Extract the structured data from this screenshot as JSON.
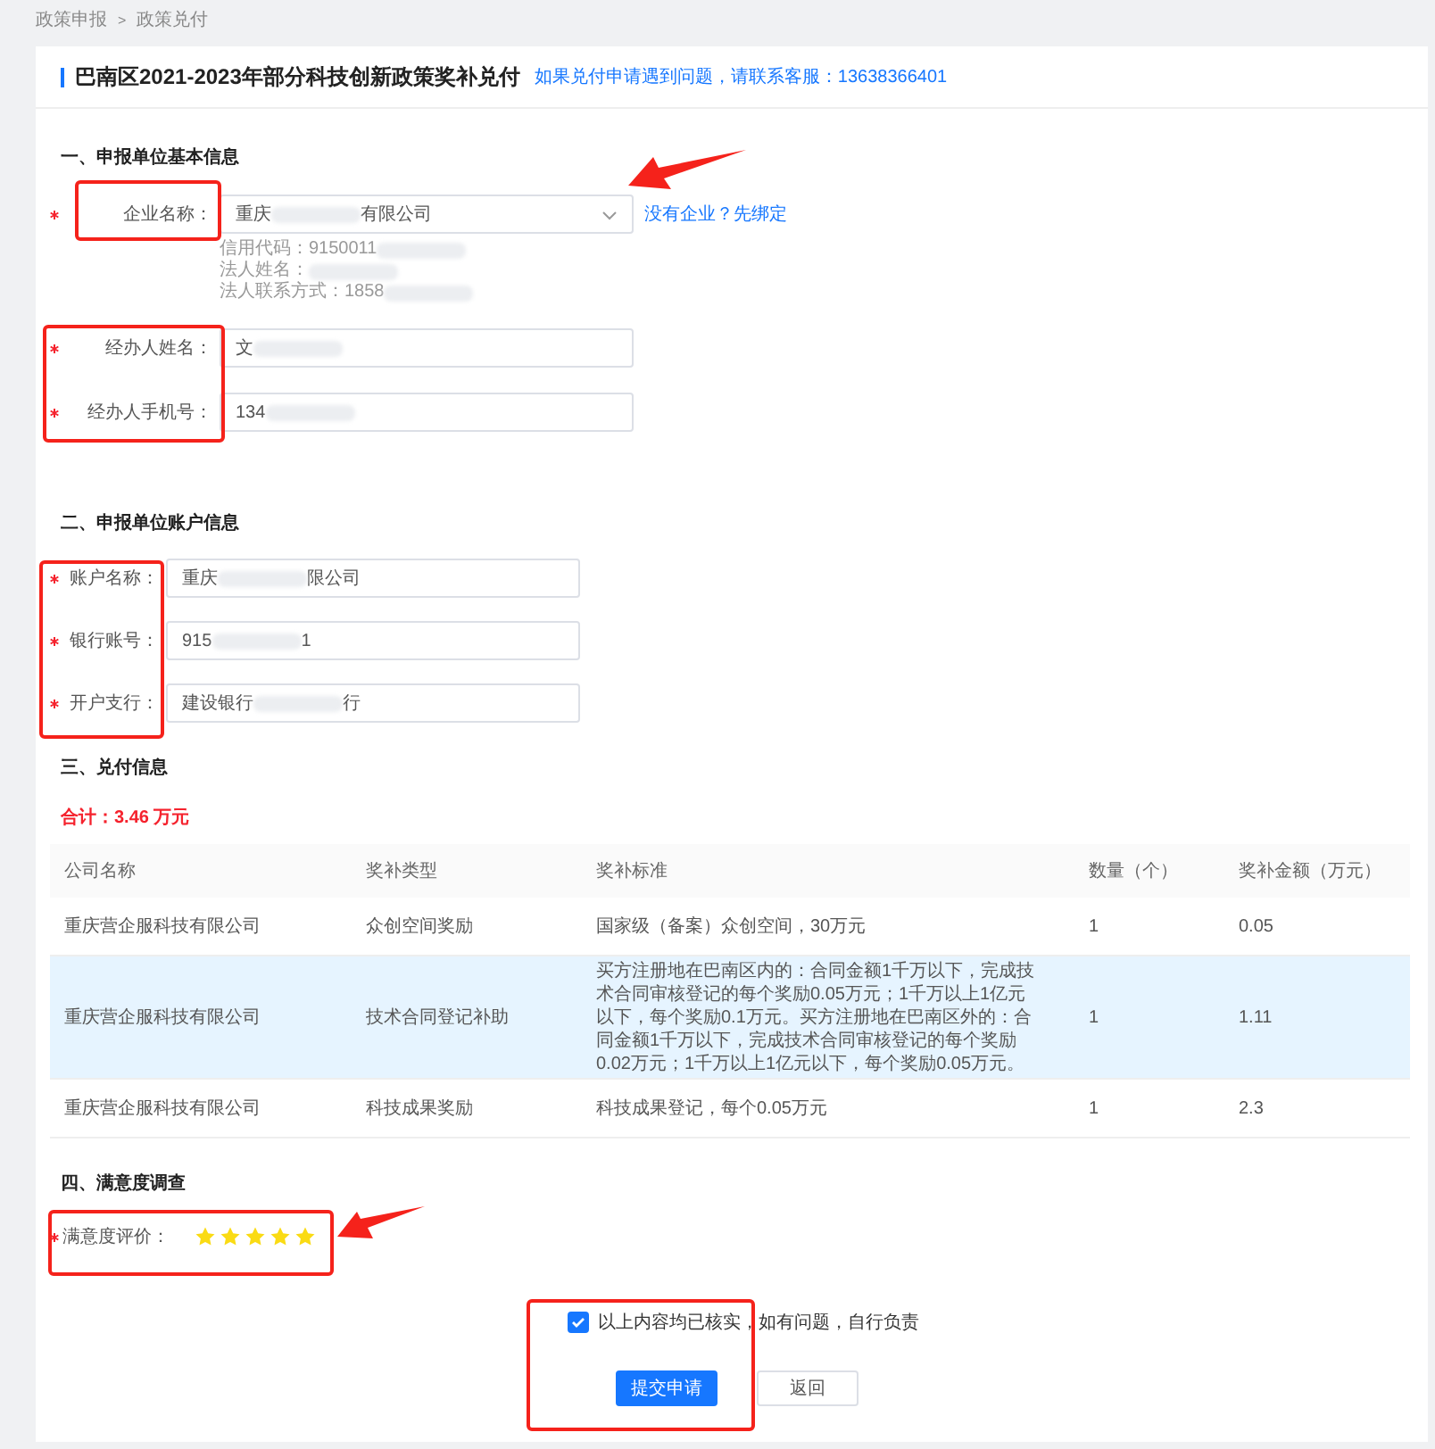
{
  "breadcrumb": [
    "政策申报",
    "政策兑付"
  ],
  "breadcrumb_separator": ">",
  "title": "巴南区2021-2023年部分科技创新政策奖补兑付",
  "help_text": "如果兑付申请遇到问题，请联系客服：13638366401",
  "section_basic": {
    "heading": "一、申报单位基本信息",
    "company": {
      "label": "企业名称：",
      "required": true,
      "value_parts": [
        "重庆",
        "有限公司"
      ],
      "bind_link": "没有企业？先绑定"
    },
    "company_info": [
      {
        "text": "信用代码：9150011"
      },
      {
        "text": "法人姓名："
      },
      {
        "text": "法人联系方式：1858"
      }
    ],
    "fields": [
      {
        "label": "经办人姓名：",
        "required": true,
        "value_parts": [
          "文"
        ]
      },
      {
        "label": "经办人手机号：",
        "required": true,
        "value_parts": [
          "134"
        ]
      }
    ]
  },
  "section_account": {
    "heading": "二、申报单位账户信息",
    "fields": [
      {
        "label": "账户名称：",
        "required": true,
        "value_parts": [
          "重庆",
          "限公司"
        ]
      },
      {
        "label": "银行账号：",
        "required": true,
        "value_parts": [
          "915",
          "1"
        ]
      },
      {
        "label": "开户支行：",
        "required": true,
        "value_parts": [
          "建设银行",
          "行"
        ]
      }
    ]
  },
  "section_payment": {
    "heading": "三、兑付信息",
    "total": "合计：3.46 万元",
    "table": {
      "columns": [
        "公司名称",
        "奖补类型",
        "奖补标准",
        "数量（个）",
        "奖补金额（万元）"
      ],
      "rows": [
        {
          "selected": false,
          "cells": [
            "重庆营企服科技有限公司",
            "众创空间奖励",
            "国家级（备案）众创空间，30万元",
            "1",
            "0.05"
          ]
        },
        {
          "selected": true,
          "cells": [
            "重庆营企服科技有限公司",
            "技术合同登记补助",
            "买方注册地在巴南区内的：合同金额1千万以下，完成技术合同审核登记的每个奖励0.05万元；1千万以上1亿元以下，每个奖励0.1万元。买方注册地在巴南区外的：合同金额1千万以下，完成技术合同审核登记的每个奖励0.02万元；1千万以上1亿元以下，每个奖励0.05万元。",
            "1",
            "1.11"
          ]
        },
        {
          "selected": false,
          "cells": [
            "重庆营企服科技有限公司",
            "科技成果奖励",
            "科技成果登记，每个0.05万元",
            "1",
            "2.3"
          ]
        }
      ]
    }
  },
  "section_survey": {
    "heading": "四、满意度调查",
    "label": "满意度评价：",
    "required": true,
    "stars": 5
  },
  "confirm": {
    "checked": true,
    "label": "以上内容均已核实，如有问题，自行负责"
  },
  "buttons": [
    {
      "label": "提交申请",
      "kind": "primary"
    },
    {
      "label": "返回",
      "kind": "default"
    }
  ]
}
